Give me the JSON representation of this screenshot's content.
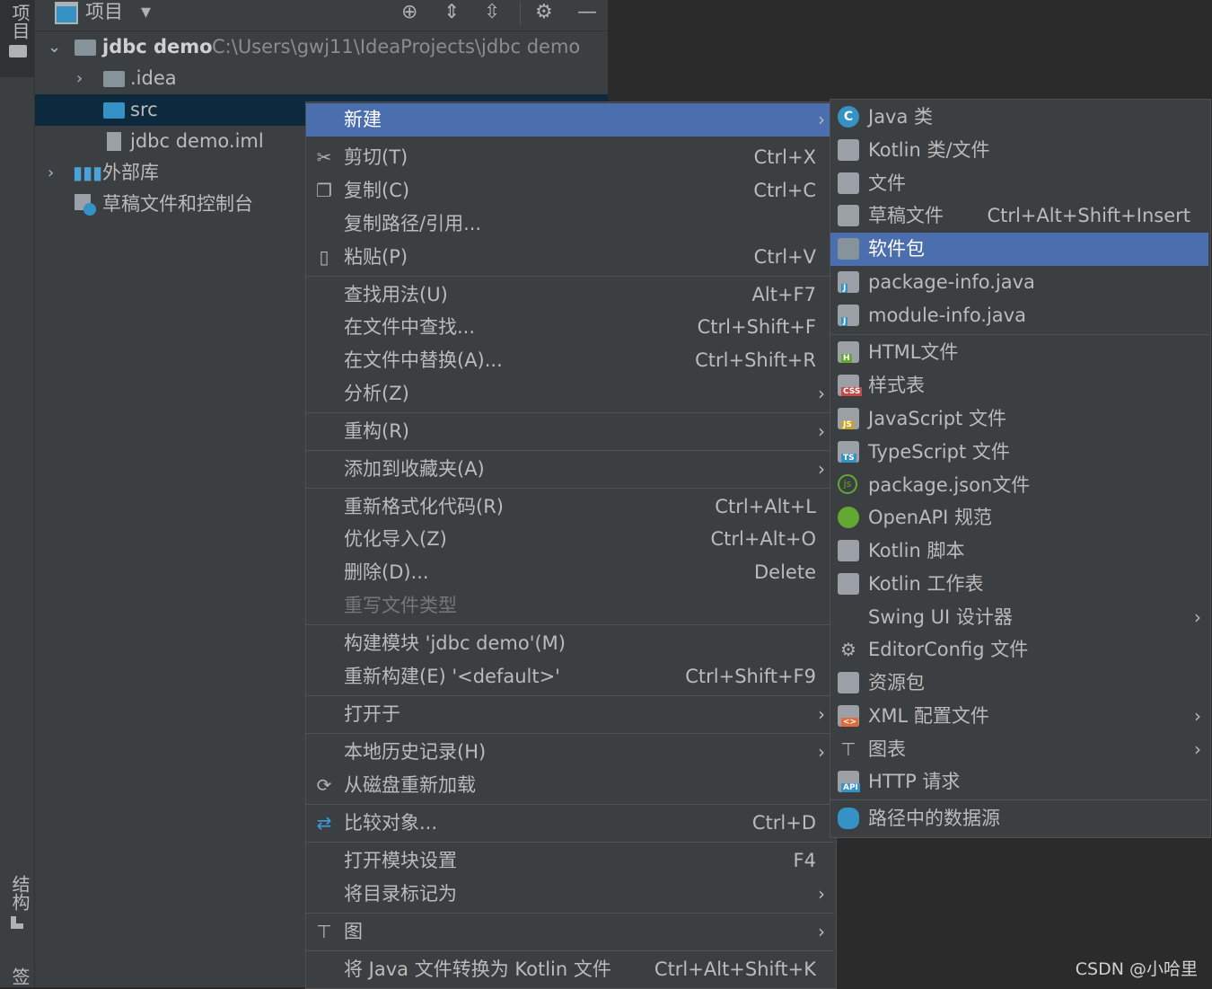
{
  "left_strip": {
    "project_label": "项目",
    "structure_label": "结构",
    "bottom_label": "书签"
  },
  "panel_header": {
    "title": "项目"
  },
  "tree": {
    "root_name": "jdbc demo",
    "root_path": "C:\\Users\\gwj11\\IdeaProjects\\jdbc demo",
    "idea": ".idea",
    "src": "src",
    "iml": "jdbc demo.iml",
    "external": "外部库",
    "scratch": "草稿文件和控制台"
  },
  "context_menu": [
    {
      "label": "新建",
      "shortcut": "",
      "submenu": true
    },
    {
      "label": "剪切(T)",
      "shortcut": "Ctrl+X"
    },
    {
      "label": "复制(C)",
      "shortcut": "Ctrl+C"
    },
    {
      "label": "复制路径/引用...",
      "shortcut": ""
    },
    {
      "label": "粘贴(P)",
      "shortcut": "Ctrl+V"
    },
    {
      "label": "查找用法(U)",
      "shortcut": "Alt+F7"
    },
    {
      "label": "在文件中查找...",
      "shortcut": "Ctrl+Shift+F"
    },
    {
      "label": "在文件中替换(A)...",
      "shortcut": "Ctrl+Shift+R"
    },
    {
      "label": "分析(Z)",
      "shortcut": ""
    },
    {
      "label": "重构(R)",
      "shortcut": ""
    },
    {
      "label": "添加到收藏夹(A)",
      "shortcut": ""
    },
    {
      "label": "重新格式化代码(R)",
      "shortcut": "Ctrl+Alt+L"
    },
    {
      "label": "优化导入(Z)",
      "shortcut": "Ctrl+Alt+O"
    },
    {
      "label": "删除(D)...",
      "shortcut": "Delete"
    },
    {
      "label": "重写文件类型",
      "shortcut": ""
    },
    {
      "label": "构建模块 'jdbc demo'(M)",
      "shortcut": ""
    },
    {
      "label": "重新构建(E) '<default>'",
      "shortcut": "Ctrl+Shift+F9"
    },
    {
      "label": "打开于",
      "shortcut": ""
    },
    {
      "label": "本地历史记录(H)",
      "shortcut": ""
    },
    {
      "label": "从磁盘重新加载",
      "shortcut": ""
    },
    {
      "label": "比较对象...",
      "shortcut": "Ctrl+D"
    },
    {
      "label": "打开模块设置",
      "shortcut": "F4"
    },
    {
      "label": "将目录标记为",
      "shortcut": ""
    },
    {
      "label": "图",
      "shortcut": ""
    },
    {
      "label": "将 Java 文件转换为 Kotlin 文件",
      "shortcut": "Ctrl+Alt+Shift+K"
    }
  ],
  "submenu": [
    {
      "label": "Java 类",
      "shortcut": ""
    },
    {
      "label": "Kotlin 类/文件",
      "shortcut": ""
    },
    {
      "label": "文件",
      "shortcut": ""
    },
    {
      "label": "草稿文件",
      "shortcut": "Ctrl+Alt+Shift+Insert"
    },
    {
      "label": "软件包",
      "shortcut": ""
    },
    {
      "label": "package-info.java",
      "shortcut": ""
    },
    {
      "label": "module-info.java",
      "shortcut": ""
    },
    {
      "label": "HTML文件",
      "shortcut": ""
    },
    {
      "label": "样式表",
      "shortcut": ""
    },
    {
      "label": "JavaScript 文件",
      "shortcut": ""
    },
    {
      "label": "TypeScript 文件",
      "shortcut": ""
    },
    {
      "label": "package.json文件",
      "shortcut": ""
    },
    {
      "label": "OpenAPI 规范",
      "shortcut": ""
    },
    {
      "label": "Kotlin 脚本",
      "shortcut": ""
    },
    {
      "label": "Kotlin 工作表",
      "shortcut": ""
    },
    {
      "label": "Swing UI 设计器",
      "shortcut": ""
    },
    {
      "label": "EditorConfig 文件",
      "shortcut": ""
    },
    {
      "label": "资源包",
      "shortcut": ""
    },
    {
      "label": "XML 配置文件",
      "shortcut": ""
    },
    {
      "label": "图表",
      "shortcut": ""
    },
    {
      "label": "HTTP 请求",
      "shortcut": ""
    },
    {
      "label": "路径中的数据源",
      "shortcut": ""
    }
  ],
  "badges": {
    "html": "H",
    "css": "CSS",
    "js": "JS",
    "ts": "TS",
    "xml": "<>",
    "api": "API",
    "java": "J"
  },
  "colors": {
    "selection": "#4b6eaf",
    "menu_bg": "#3c3f41",
    "tree_selection": "#0d293e"
  },
  "watermark": "CSDN @小哈里"
}
